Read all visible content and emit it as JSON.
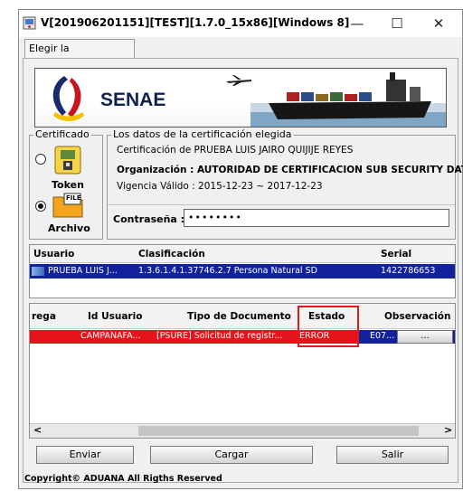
{
  "window": {
    "title": "V[201906201151][TEST][1.7.0_15x86][Windows 8]",
    "minimize": "—",
    "maximize": "☐",
    "close": "✕"
  },
  "tab": {
    "label": "Elegir la Certificación"
  },
  "banner": {
    "brand": "SENAE"
  },
  "cert_group": {
    "legend": "Certificado",
    "token_label": "Token",
    "archivo_label": "Archivo",
    "file_icon_text": "FILE",
    "selected": "Archivo"
  },
  "cert_info": {
    "legend": "Los datos de la certificación elegida",
    "line1": "Certificación de PRUEBA LUIS JAIRO QUIJIJE REYES",
    "line2": "Organización : AUTORIDAD DE CERTIFICACION SUB SECURITY DATA",
    "line3": "Vigencia Válido : 2015-12-23 ~ 2017-12-23",
    "password_label": "Contraseña :",
    "password_value": "••••••••"
  },
  "cert_table": {
    "headers": [
      "Usuario",
      "Clasificación",
      "Serial"
    ],
    "row": {
      "usuario": "PRUEBA LUIS J...",
      "clasificacion": "1.3.6.1.4.1.37746.2.7 Persona Natural SD",
      "serial": "1422786653"
    }
  },
  "doc_table": {
    "headers": [
      "rega",
      "Id Usuario",
      "Tipo de Documento",
      "Estado",
      "Observación"
    ],
    "row": {
      "id_usuario": "CAMPANAFA...",
      "tipo": "[PSURE] Solicitud de registr...",
      "estado": "ERROR",
      "observacion": "E07...",
      "detail_btn": "..."
    },
    "scroll_left": "<",
    "scroll_right": ">"
  },
  "buttons": {
    "enviar": "Enviar",
    "cargar": "Cargar",
    "salir": "Salir"
  },
  "footer": {
    "copyright": "Copyright© ADUANA All Rigths Reserved"
  },
  "colors": {
    "selection_blue": "#12229a",
    "error_red": "#e4141a",
    "highlight": "#e01b1b"
  }
}
